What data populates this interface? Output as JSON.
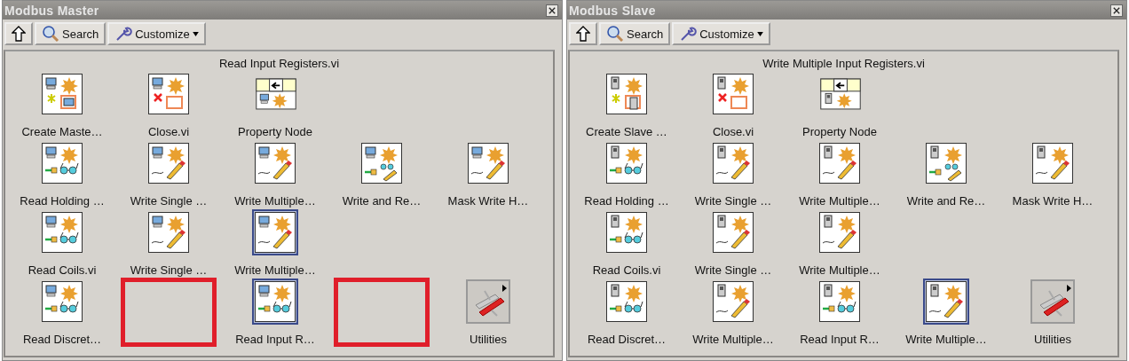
{
  "panels": [
    {
      "title": "Modbus Master",
      "kind": "master",
      "toolbar": {
        "search": "Search",
        "customize": "Customize"
      },
      "header": "Read Input Registers.vi",
      "rows": [
        [
          {
            "label": "Create Maste…",
            "kind": "create",
            "selected": false
          },
          {
            "label": "Close.vi",
            "kind": "close",
            "selected": false
          },
          {
            "label": "Property Node",
            "kind": "property",
            "selected": false
          }
        ],
        [
          {
            "label": "Read Holding …",
            "kind": "read",
            "selected": false
          },
          {
            "label": "Write Single …",
            "kind": "write",
            "selected": false
          },
          {
            "label": "Write Multiple…",
            "kind": "write",
            "selected": false
          },
          {
            "label": "Write and Re…",
            "kind": "readwrite",
            "selected": false
          },
          {
            "label": "Mask Write H…",
            "kind": "write",
            "selected": false
          }
        ],
        [
          {
            "label": "Read Coils.vi",
            "kind": "read",
            "selected": false
          },
          {
            "label": "Write Single …",
            "kind": "write",
            "selected": false
          },
          {
            "label": "Write Multiple…",
            "kind": "write",
            "selected": true
          }
        ],
        [
          {
            "label": "Read Discret…",
            "kind": "read",
            "selected": false
          },
          {
            "kind": "missing"
          },
          {
            "label": "Read Input R…",
            "kind": "read",
            "selected": true
          },
          {
            "kind": "missing"
          },
          {
            "label": "Utilities",
            "kind": "folder",
            "selected": false
          }
        ]
      ]
    },
    {
      "title": "Modbus Slave",
      "kind": "slave",
      "toolbar": {
        "search": "Search",
        "customize": "Customize"
      },
      "header": "Write Multiple Input Registers.vi",
      "rows": [
        [
          {
            "label": "Create Slave …",
            "kind": "create",
            "selected": false
          },
          {
            "label": "Close.vi",
            "kind": "close",
            "selected": false
          },
          {
            "label": "Property Node",
            "kind": "property",
            "selected": false
          }
        ],
        [
          {
            "label": "Read Holding …",
            "kind": "read",
            "selected": false
          },
          {
            "label": "Write Single …",
            "kind": "write",
            "selected": false
          },
          {
            "label": "Write Multiple…",
            "kind": "write",
            "selected": false
          },
          {
            "label": "Write and Re…",
            "kind": "readwrite",
            "selected": false
          },
          {
            "label": "Mask Write H…",
            "kind": "write",
            "selected": false
          }
        ],
        [
          {
            "label": "Read Coils.vi",
            "kind": "read",
            "selected": false
          },
          {
            "label": "Write Single …",
            "kind": "write",
            "selected": false
          },
          {
            "label": "Write Multiple…",
            "kind": "write",
            "selected": false
          }
        ],
        [
          {
            "label": "Read Discret…",
            "kind": "read",
            "selected": false
          },
          {
            "label": "Write Multiple…",
            "kind": "write",
            "selected": false
          },
          {
            "label": "Read Input R…",
            "kind": "read",
            "selected": false
          },
          {
            "label": "Write Multiple…",
            "kind": "write",
            "selected": true
          },
          {
            "label": "Utilities",
            "kind": "folder",
            "selected": false
          }
        ]
      ]
    }
  ]
}
